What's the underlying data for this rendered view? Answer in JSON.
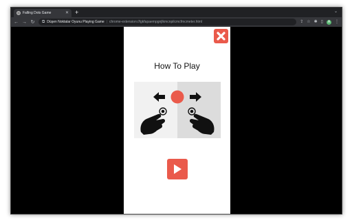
{
  "browser": {
    "tab_title": "Falling Dots Game",
    "new_tab_symbol": "+",
    "extension_name": "Düşen Noktalar Oyunu Playing Game",
    "url": "chrome-extension://lgkfapaempgnjlkmcnpilcmcfmcmeter.html",
    "profile_initial": "A"
  },
  "game": {
    "title": "How To Play"
  }
}
